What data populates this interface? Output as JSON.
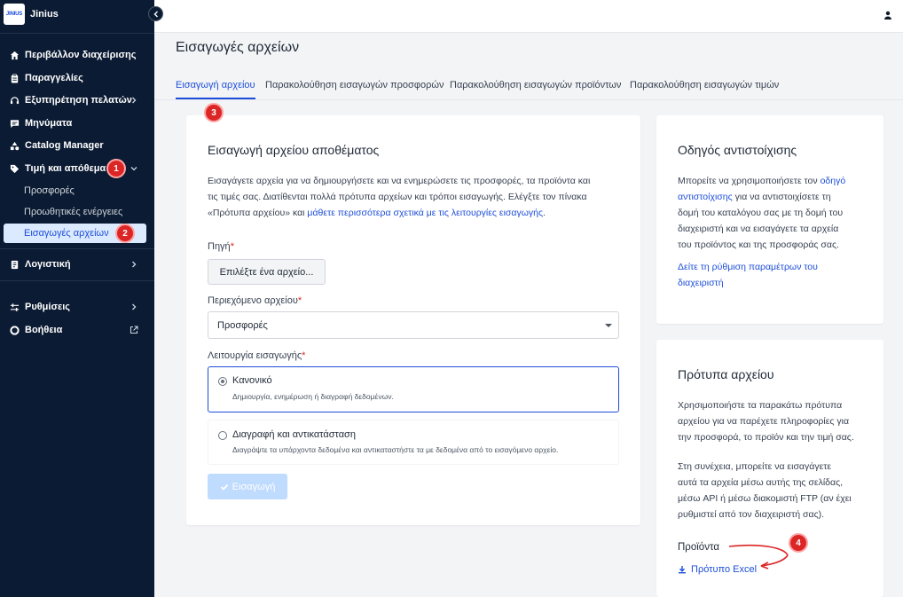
{
  "brand": {
    "logo_text": "JINIUS",
    "name": "Jinius"
  },
  "sidebar": {
    "items": [
      {
        "label": "Περιβάλλον διαχείρισης",
        "icon": "home-icon"
      },
      {
        "label": "Παραγγελίες",
        "icon": "clipboard-icon"
      },
      {
        "label": "Εξυπηρέτηση πελατών",
        "icon": "headset-icon"
      },
      {
        "label": "Μηνύματα",
        "icon": "message-icon"
      },
      {
        "label": "Catalog Manager",
        "icon": "shapes-icon"
      },
      {
        "label": "Τιμή και απόθεμα",
        "icon": "tag-icon"
      },
      {
        "label": "Λογιστική",
        "icon": "ledger-icon"
      },
      {
        "label": "Ρυθμίσεις",
        "icon": "sliders-icon"
      },
      {
        "label": "Βοήθεια",
        "icon": "lifebuoy-icon"
      }
    ],
    "sub_items": [
      "Προσφορές",
      "Προωθητικές ενέργειες",
      "Εισαγωγές αρχείων"
    ]
  },
  "markers": [
    "1",
    "2",
    "3",
    "4"
  ],
  "page": {
    "title": "Εισαγωγές αρχείων",
    "tabs": [
      "Εισαγωγή αρχείου",
      "Παρακολούθηση εισαγωγών προσφορών",
      "Παρακολούθηση εισαγωγών προϊόντων",
      "Παρακολούθηση εισαγωγών τιμών"
    ]
  },
  "import_card": {
    "title": "Εισαγωγή αρχείου αποθέματος",
    "intro_line1": "Εισαγάγετε αρχεία για να δημιουργήσετε και να ενημερώσετε τις προσφορές, τα προϊόντα και",
    "intro_line2": "τις τιμές σας. Διατίθενται πολλά πρότυπα αρχείων και τρόποι εισαγωγής. Ελέγξτε τον πίνακα",
    "intro_line3": "«Πρότυπα αρχείου» και ",
    "intro_link": "μάθετε περισσότερα σχετικά με τις λειτουργίες εισαγωγής",
    "intro_end": ".",
    "source_label": "Πηγή",
    "required_mark": "*",
    "file_button": "Επιλέξτε ένα αρχείο...",
    "content_label": "Περιεχόμενο αρχείου",
    "content_value": "Προσφορές",
    "mode_label": "Λειτουργία εισαγωγής",
    "modes": [
      {
        "title": "Κανονικό",
        "desc": "Δημιουργία, ενημέρωση ή διαγραφή δεδομένων.",
        "selected": true
      },
      {
        "title": "Διαγραφή και αντικατάσταση",
        "desc": "Διαγράψτε τα υπάρχοντα δεδομένα και αντικαταστήστε τα με δεδομένα από το εισαγόμενο αρχείο.",
        "selected": false
      }
    ],
    "submit_label": "Εισαγωγή"
  },
  "guide_card": {
    "title": "Οδηγός αντιστοίχισης",
    "line1_text": "Μπορείτε να χρησιμοποιήσετε τον ",
    "line1_link": "οδηγό",
    "line2_link": "αντιστοίχισης",
    "line2_text": " για να αντιστοιχίσετε τη",
    "line3": "δομή του καταλόγου σας με τη δομή του",
    "line4": "διαχειριστή και να εισαγάγετε τα αρχεία",
    "line5": "του προϊόντος και της προσφοράς σας.",
    "settings_link_line1": "Δείτε τη ρύθμιση παραμέτρων του",
    "settings_link_line2": "διαχειριστή"
  },
  "templates_card": {
    "title": "Πρότυπα αρχείου",
    "p1": [
      "Χρησιμοποιήστε τα παρακάτω πρότυπα",
      "αρχείου για να παρέχετε πληροφορίες για",
      "την προσφορά, το προϊόν και την τιμή σας."
    ],
    "p2": [
      "Στη συνέχεια, μπορείτε να εισαγάγετε",
      "αυτά τα αρχεία μέσω αυτής της σελίδας,",
      "μέσω API ή μέσω διακομιστή FTP (αν έχει",
      "ρυθμιστεί από τον διαχειριστή σας)."
    ],
    "products_label": "Προϊόντα",
    "excel_link": "Πρότυπο Excel"
  },
  "colors": {
    "sidebar_bg": "#0b1b33",
    "accent": "#1d4ed8",
    "marker": "#dc2626"
  }
}
